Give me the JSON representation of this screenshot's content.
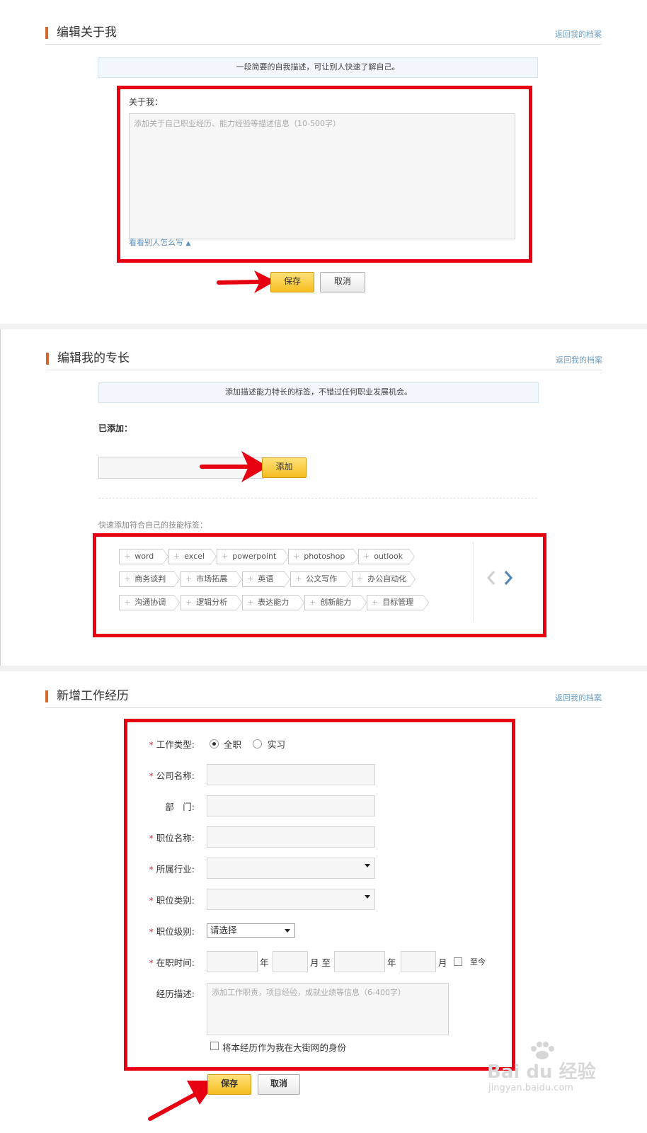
{
  "about": {
    "title": "编辑关于我",
    "back_link": "返回我的档案",
    "notice": "一段简要的自我描述，可让别人快速了解自己。",
    "field_label": "关于我：",
    "placeholder": "添加关于自己职业经历、能力经验等描述信息（10-500字）",
    "examples_link": "看看别人怎么写",
    "save_label": "保存",
    "cancel_label": "取消"
  },
  "skills": {
    "title": "编辑我的专长",
    "back_link": "返回我的档案",
    "notice": "添加描述能力特长的标签，不错过任何职业发展机会。",
    "added_label": "已添加：",
    "add_button": "添加",
    "quick_label": "快速添加符合自己的技能标签：",
    "tags_row1": [
      "word",
      "excel",
      "powerpoint",
      "photoshop",
      "outlook"
    ],
    "tags_row2": [
      "商务谈判",
      "市场拓展",
      "英语",
      "公文写作",
      "办公自动化"
    ],
    "tags_row3": [
      "沟通协调",
      "逻辑分析",
      "表达能力",
      "创新能力",
      "目标管理"
    ],
    "plus": "+"
  },
  "work": {
    "title": "新增工作经历",
    "back_link": "返回我的档案",
    "required_mark": "*",
    "job_type_label": "工作类型:",
    "job_type_options": [
      "全职",
      "实习"
    ],
    "company_label": "公司名称:",
    "department_label": "部　门:",
    "position_label": "职位名称:",
    "industry_label": "所属行业:",
    "category_label": "职位类别:",
    "level_label": "职位级别:",
    "level_value": "请选择",
    "tenure_label": "在职时间:",
    "year": "年",
    "month_to": "月 至",
    "month": "月",
    "until_now": "至今",
    "desc_label": "经历描述:",
    "desc_placeholder": "添加工作职责，项目经验，成就业绩等信息（6-400字）",
    "identity_checkbox": "将本经历作为我在大街网的身份",
    "save_label": "保存",
    "cancel_label": "取消"
  },
  "watermark": {
    "brand": "Bai du 经验",
    "url": "jingyan.baidu.com"
  },
  "colors": {
    "accent_bar": "#d3682f",
    "highlight_red": "#e60012",
    "link": "#6e9ec4",
    "button_yellow": "#f6bd20"
  }
}
